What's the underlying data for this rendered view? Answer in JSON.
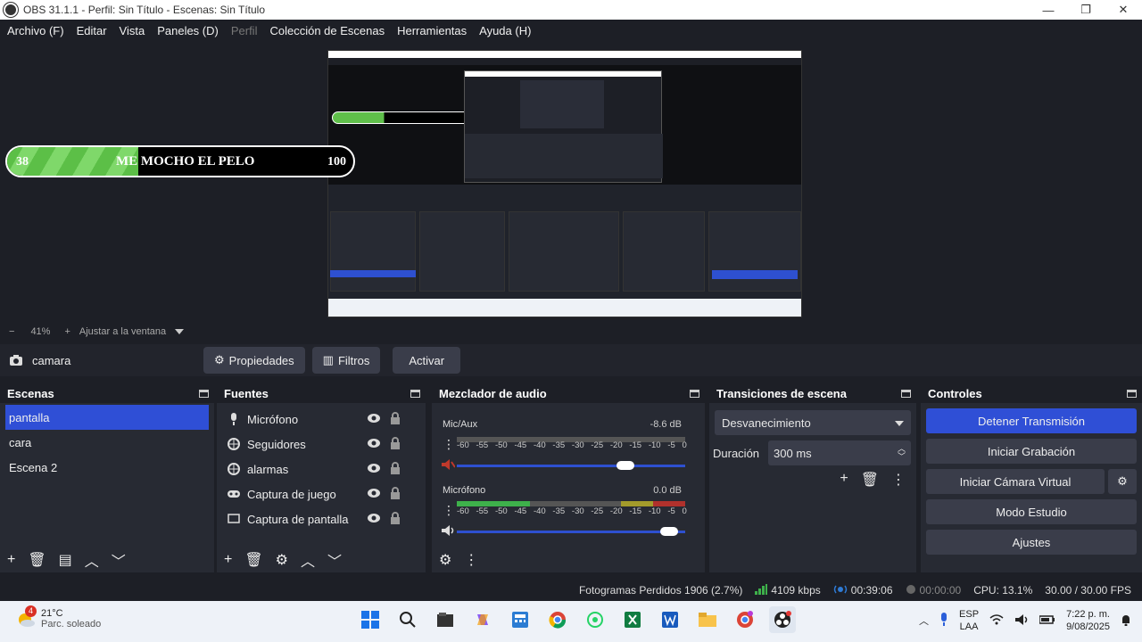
{
  "window": {
    "title": "OBS 31.1.1 - Perfil: Sin Título - Escenas: Sin Título",
    "minimize": "—",
    "maximize": "❐",
    "close": "✕"
  },
  "menu": {
    "items": [
      "Archivo (F)",
      "Editar",
      "Vista",
      "Paneles (D)",
      "Perfil",
      "Colección de Escenas",
      "Herramientas",
      "Ayuda (H)"
    ]
  },
  "preview": {
    "progress": {
      "start": "38",
      "label": "ME MOCHO EL PELO",
      "end": "100",
      "fill_fraction": 0.38
    }
  },
  "zoom": {
    "minus": "−",
    "percent": "41%",
    "plus": "+",
    "fit_label": "Ajustar a la ventana"
  },
  "source_toolbar": {
    "source_name": "camara",
    "properties": "Propiedades",
    "filters": "Filtros",
    "activate": "Activar"
  },
  "scenes": {
    "title": "Escenas",
    "items": [
      "pantalla",
      "cara",
      "Escena 2"
    ],
    "active_index": 0
  },
  "sources": {
    "title": "Fuentes",
    "items": [
      {
        "label": "Micrófono",
        "icon": "microphone-icon"
      },
      {
        "label": "Seguidores",
        "icon": "browser-icon"
      },
      {
        "label": "alarmas",
        "icon": "browser-icon"
      },
      {
        "label": "Captura de juego",
        "icon": "gamepad-icon"
      },
      {
        "label": "Captura de pantalla",
        "icon": "monitor-icon"
      }
    ]
  },
  "mixer": {
    "title": "Mezclador de audio",
    "ticks": [
      "-60",
      "-55",
      "-50",
      "-45",
      "-40",
      "-35",
      "-30",
      "-25",
      "-20",
      "-15",
      "-10",
      "-5",
      "0"
    ],
    "channels": [
      {
        "name": "Mic/Aux",
        "db": "-8.6 dB",
        "muted": true,
        "level_fraction": 0.0,
        "volume_fraction": 0.7
      },
      {
        "name": "Micrófono",
        "db": "0.0 dB",
        "muted": false,
        "level_fraction": 0.32,
        "volume_fraction": 0.97
      }
    ]
  },
  "transitions": {
    "title": "Transiciones de escena",
    "selected": "Desvanecimiento",
    "duration_label": "Duración",
    "duration_value": "300 ms"
  },
  "controls": {
    "title": "Controles",
    "stop_stream": "Detener Transmisión",
    "start_recording": "Iniciar Grabación",
    "start_virtual_cam": "Iniciar Cámara Virtual",
    "studio_mode": "Modo Estudio",
    "settings": "Ajustes"
  },
  "status": {
    "dropped_frames": "Fotogramas Perdidos 1906 (2.7%)",
    "bitrate": "4109 kbps",
    "stream_time": "00:39:06",
    "record_time": "00:00:00",
    "cpu": "CPU: 13.1%",
    "fps": "30.00 / 30.00 FPS",
    "colors": {
      "good": "#3eb14b",
      "stream": "#2e7bd6"
    }
  },
  "taskbar": {
    "weather_badge": "4",
    "temperature": "21°C",
    "condition": "Parc. soleado",
    "lang1": "ESP",
    "lang2": "LAA",
    "time": "7:22 p. m.",
    "date": "9/08/2025",
    "apps": [
      "windows-start-icon",
      "search-icon",
      "file-manager-icon",
      "copilot-icon",
      "calculator-icon",
      "chrome-icon",
      "whatsapp-icon",
      "excel-icon",
      "word-icon",
      "folder-icon",
      "chrome-profile-icon",
      "obs-icon"
    ]
  }
}
